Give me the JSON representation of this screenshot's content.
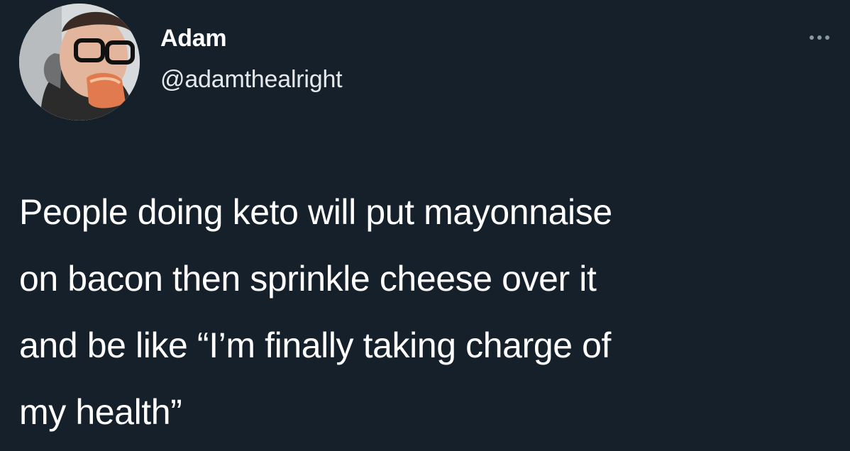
{
  "author": {
    "display_name": "Adam",
    "handle": "@adamthealright",
    "avatar_icon": "profile-photo"
  },
  "menu": {
    "icon": "more-options-icon"
  },
  "tweet": {
    "lines": [
      "People doing keto will put mayonnaise",
      "on bacon then sprinkle cheese over it",
      "and be like “I’m finally taking charge of",
      "my health”"
    ]
  },
  "colors": {
    "background": "#15202b",
    "text_primary": "#ffffff",
    "text_secondary": "#e6e9eb",
    "icon_muted": "#8899a6"
  }
}
